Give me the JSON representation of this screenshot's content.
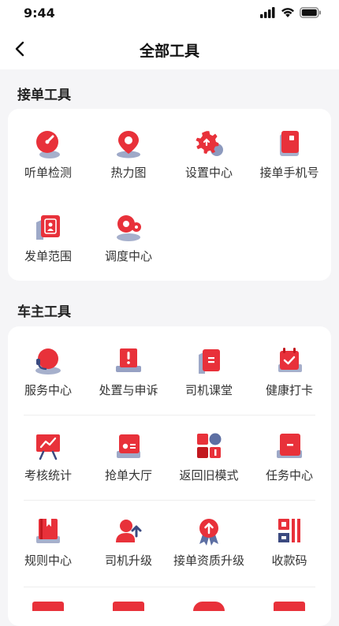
{
  "status": {
    "time": "9:44"
  },
  "header": {
    "title": "全部工具"
  },
  "sections": [
    {
      "title": "接单工具",
      "items": [
        {
          "label": "听单检测",
          "icon": "gauge-icon"
        },
        {
          "label": "热力图",
          "icon": "map-pin-icon"
        },
        {
          "label": "设置中心",
          "icon": "settings-gear-icon"
        },
        {
          "label": "接单手机号",
          "icon": "phone-card-icon"
        },
        {
          "label": "发单范围",
          "icon": "range-user-icon"
        },
        {
          "label": "调度中心",
          "icon": "dispatch-pin-icon"
        }
      ]
    },
    {
      "title": "车主工具",
      "items": [
        {
          "label": "服务中心",
          "icon": "headset-icon"
        },
        {
          "label": "处置与申诉",
          "icon": "alert-board-icon"
        },
        {
          "label": "司机课堂",
          "icon": "notebook-icon"
        },
        {
          "label": "健康打卡",
          "icon": "calendar-check-icon"
        },
        {
          "label": "考核统计",
          "icon": "chart-board-icon"
        },
        {
          "label": "抢单大厅",
          "icon": "grab-order-card-icon"
        },
        {
          "label": "返回旧模式",
          "icon": "shapes-icon"
        },
        {
          "label": "任务中心",
          "icon": "task-folder-icon"
        },
        {
          "label": "规则中心",
          "icon": "rule-book-icon"
        },
        {
          "label": "司机升级",
          "icon": "driver-upgrade-icon"
        },
        {
          "label": "接单资质升级",
          "icon": "qualification-badge-icon"
        },
        {
          "label": "收款码",
          "icon": "payment-code-icon"
        }
      ]
    }
  ],
  "colors": {
    "accent": "#e8313a",
    "accent_dark": "#c2181f",
    "shadow": "#5d6fa3"
  }
}
